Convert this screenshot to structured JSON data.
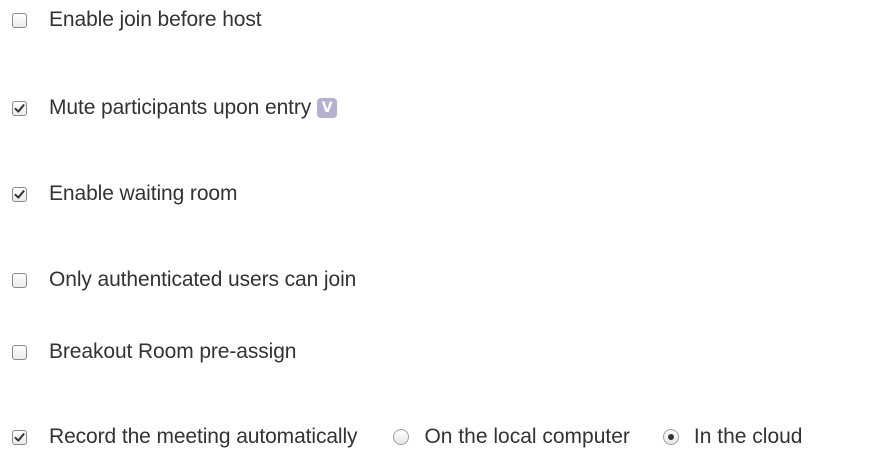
{
  "options": [
    {
      "label": "Enable join before host",
      "checked": false
    },
    {
      "label": "Mute participants upon entry",
      "checked": true,
      "badge": "V"
    },
    {
      "label": "Enable waiting room",
      "checked": true
    },
    {
      "label": "Only authenticated users can join",
      "checked": false
    },
    {
      "label": "Breakout Room pre-assign",
      "checked": false
    },
    {
      "label": "Record the meeting automatically",
      "checked": true
    }
  ],
  "record_location": {
    "options": [
      {
        "label": "On the local computer",
        "selected": false
      },
      {
        "label": "In the cloud",
        "selected": true
      }
    ]
  },
  "colors": {
    "text": "#333333",
    "badge": "#b4b2cf",
    "border": "#8a8a8a"
  },
  "icons": {
    "check": "checkmark-icon",
    "badge": "version-badge-icon"
  }
}
